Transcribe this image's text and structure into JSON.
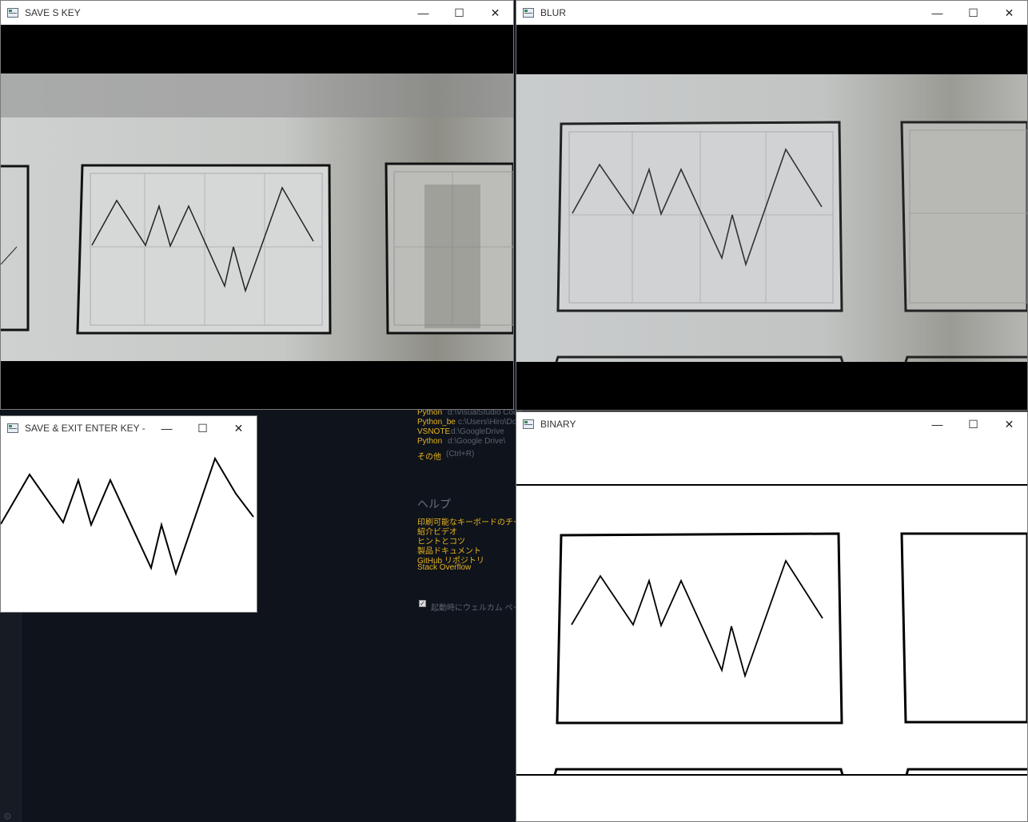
{
  "windows": {
    "save": {
      "title": "SAVE S KEY"
    },
    "blur": {
      "title": "BLUR"
    },
    "exit": {
      "title": "SAVE & EXIT ENTER KEY - E..."
    },
    "binary": {
      "title": "BINARY"
    }
  },
  "controls": {
    "minimize": "—",
    "maximize": "☐",
    "close": "✕"
  },
  "vscode": {
    "recent": [
      {
        "name": "Python",
        "path": "d:\\VisualStudio Code"
      },
      {
        "name": "Python_be",
        "path": "c:\\Users\\Hiro\\Doc"
      },
      {
        "name": "VSNOTE",
        "path": "d:\\GoogleDrive"
      },
      {
        "name": "Python",
        "path": "d:\\Google Drive\\"
      }
    ],
    "more": {
      "label": "その他",
      "shortcut": "(Ctrl+R)"
    },
    "help_heading": "ヘルプ",
    "help_links": [
      "印刷可能なキーボードのチート",
      "紹介ビデオ",
      "ヒントとコツ",
      "製品ドキュメント",
      "GitHub リポジトリ",
      "Stack Overflow"
    ],
    "startup_checkbox": "起動時にウェルカム ペー",
    "startup_checked": true
  },
  "colors": {
    "accent_link": "#e6b422",
    "editor_bg": "#0f131b"
  }
}
